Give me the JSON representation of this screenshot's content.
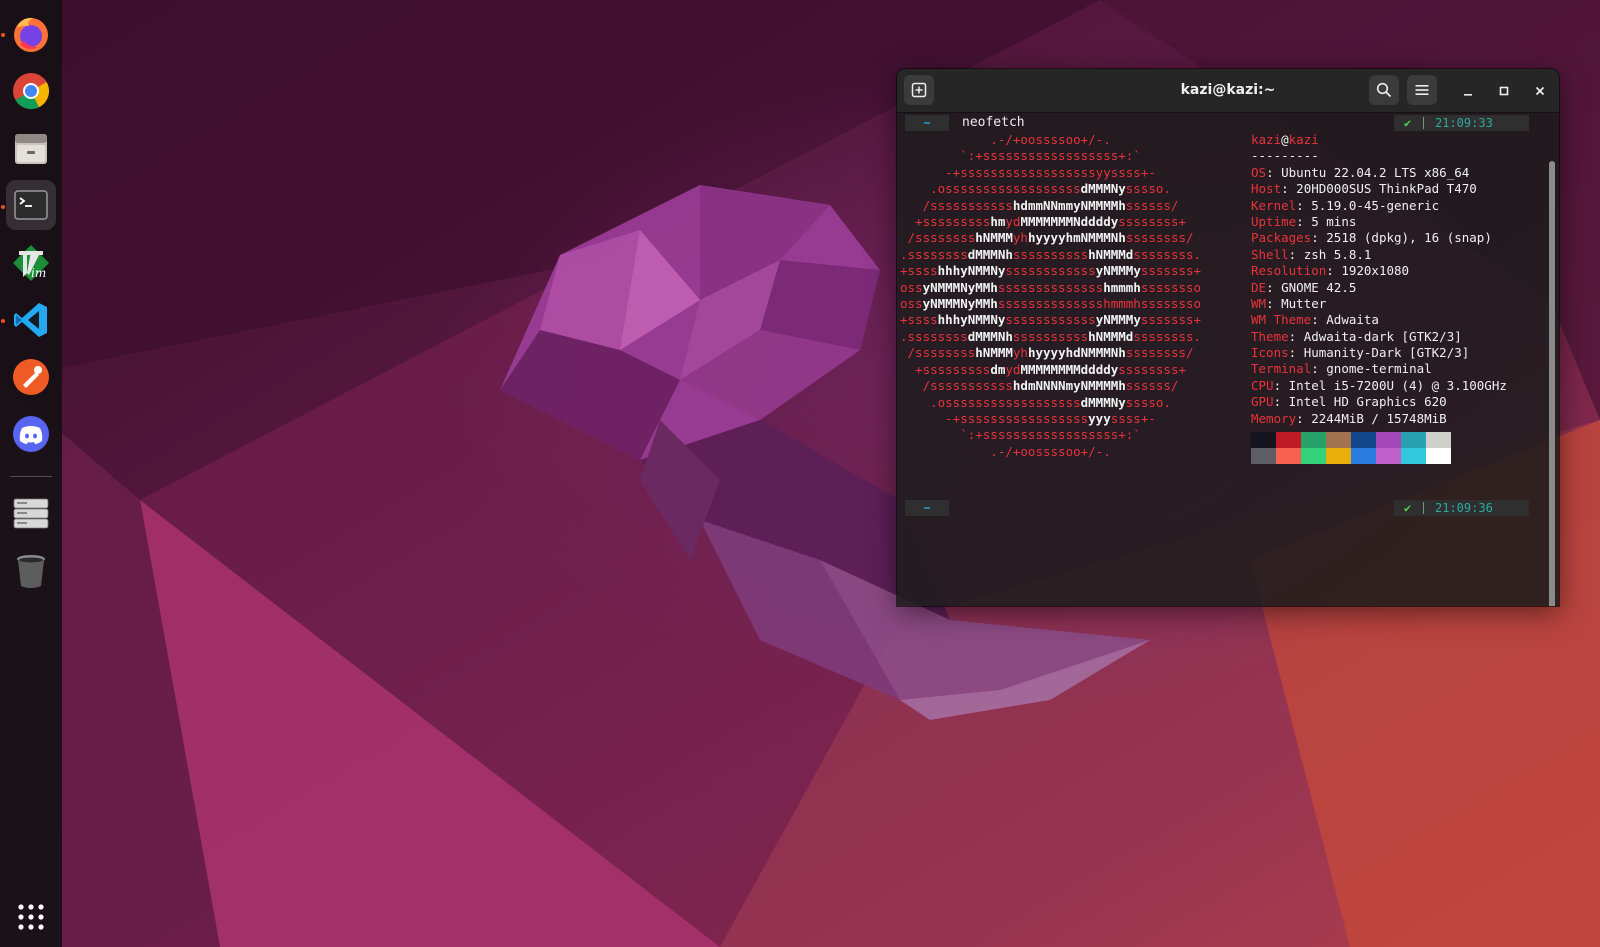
{
  "dock": {
    "items": [
      {
        "name": "firefox",
        "icon": "firefox-icon",
        "running": true
      },
      {
        "name": "chrome",
        "icon": "chrome-icon",
        "running": false
      },
      {
        "name": "files",
        "icon": "files-icon",
        "running": false
      },
      {
        "name": "terminal",
        "icon": "terminal-icon",
        "running": true,
        "active": true
      },
      {
        "name": "vim",
        "icon": "vim-icon",
        "running": false
      },
      {
        "name": "vscode",
        "icon": "vscode-icon",
        "running": true
      },
      {
        "name": "postman",
        "icon": "postman-icon",
        "running": false
      },
      {
        "name": "discord",
        "icon": "discord-icon",
        "running": false
      },
      {
        "name": "drives",
        "icon": "drive-icon",
        "running": false
      },
      {
        "name": "trash",
        "icon": "trash-icon",
        "running": false
      }
    ],
    "apps_grid_icon": "show-apps-icon"
  },
  "terminal": {
    "title": "kazi@kazi:~",
    "prompt1": {
      "dir": "~",
      "command": "neofetch",
      "status_icon": "✔",
      "time": "21:09:33"
    },
    "prompt2": {
      "dir": "~",
      "command": "",
      "status_icon": "✔",
      "time": "21:09:36"
    },
    "info": {
      "user": "kazi",
      "at": "@",
      "host": "kazi",
      "separator": "---------",
      "rows": [
        {
          "key": "OS",
          "value": "Ubuntu 22.04.2 LTS x86_64"
        },
        {
          "key": "Host",
          "value": "20HD000SUS ThinkPad T470"
        },
        {
          "key": "Kernel",
          "value": "5.19.0-45-generic"
        },
        {
          "key": "Uptime",
          "value": "5 mins"
        },
        {
          "key": "Packages",
          "value": "2518 (dpkg), 16 (snap)"
        },
        {
          "key": "Shell",
          "value": "zsh 5.8.1"
        },
        {
          "key": "Resolution",
          "value": "1920x1080"
        },
        {
          "key": "DE",
          "value": "GNOME 42.5"
        },
        {
          "key": "WM",
          "value": "Mutter"
        },
        {
          "key": "WM Theme",
          "value": "Adwaita"
        },
        {
          "key": "Theme",
          "value": "Adwaita-dark [GTK2/3]"
        },
        {
          "key": "Icons",
          "value": "Humanity-Dark [GTK2/3]"
        },
        {
          "key": "Terminal",
          "value": "gnome-terminal"
        },
        {
          "key": "CPU",
          "value": "Intel i5-7200U (4) @ 3.100GHz"
        },
        {
          "key": "GPU",
          "value": "Intel HD Graphics 620"
        },
        {
          "key": "Memory",
          "value": "2244MiB / 15748MiB"
        }
      ]
    },
    "palette": {
      "normal": [
        "#171421",
        "#c01c28",
        "#26a269",
        "#a2734c",
        "#12488b",
        "#a347ba",
        "#2aa1b3",
        "#d0cfcc"
      ],
      "bright": [
        "#5e5c64",
        "#f66151",
        "#33d17a",
        "#e9ad0c",
        "#2a7bde",
        "#c061cb",
        "#33c7de",
        "#ffffff"
      ]
    }
  }
}
